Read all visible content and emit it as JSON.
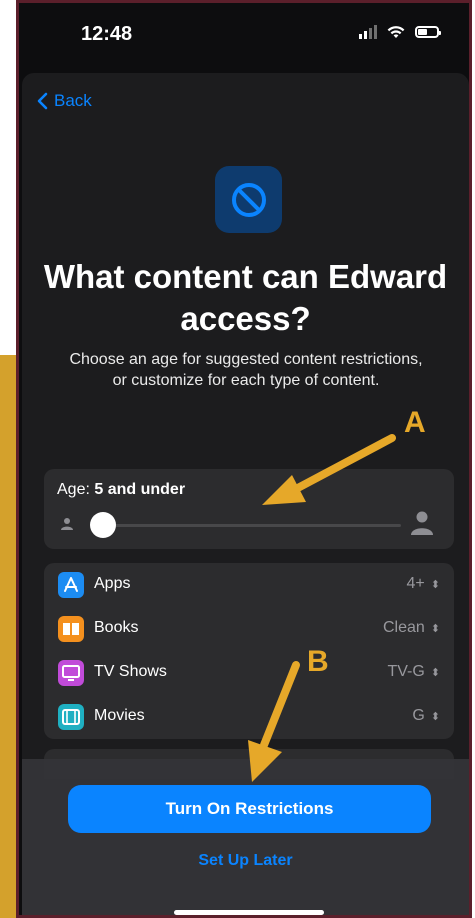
{
  "status_bar": {
    "time": "12:48"
  },
  "nav": {
    "back_label": "Back"
  },
  "header": {
    "title": "What content can Edward access?",
    "subtitle": "Choose an age for suggested content restrictions, or customize for each type of content."
  },
  "age": {
    "label_prefix": "Age:",
    "value": "5 and under"
  },
  "content_types": [
    {
      "name": "Apps",
      "value": "4+",
      "icon": "app-store-icon",
      "color": "#1c8cf2"
    },
    {
      "name": "Books",
      "value": "Clean",
      "icon": "books-icon",
      "color": "#f4901e"
    },
    {
      "name": "TV Shows",
      "value": "TV-G",
      "icon": "tv-icon",
      "color": "#c14bd9"
    },
    {
      "name": "Movies",
      "value": "G",
      "icon": "film-icon",
      "color": "#1fb0c2"
    }
  ],
  "actions": {
    "primary": "Turn On Restrictions",
    "secondary": "Set Up Later"
  },
  "annotations": {
    "a": "A",
    "b": "B"
  },
  "colors": {
    "accent": "#0a84ff",
    "annotation": "#e6a829",
    "frame": "#5b1f2b"
  }
}
